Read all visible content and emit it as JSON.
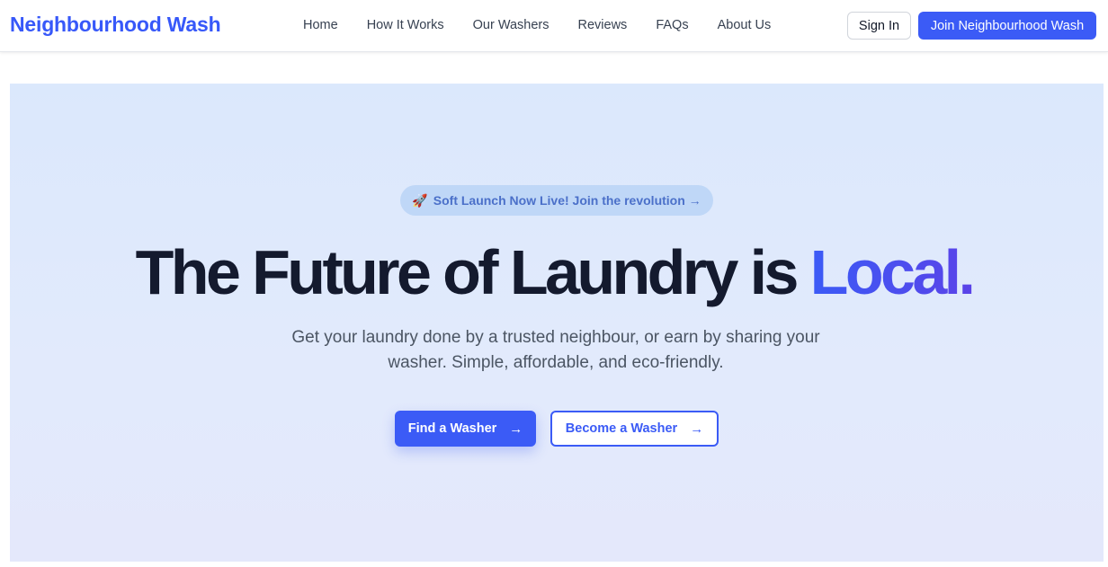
{
  "header": {
    "logo": "Neighbourhood Wash",
    "nav": [
      {
        "label": "Home"
      },
      {
        "label": "How It Works"
      },
      {
        "label": "Our Washers"
      },
      {
        "label": "Reviews"
      },
      {
        "label": "FAQs"
      },
      {
        "label": "About Us"
      }
    ],
    "sign_in_label": "Sign In",
    "join_label": "Join Neighbourhood Wash"
  },
  "hero": {
    "badge_icon": "🚀",
    "badge_text": "Soft Launch Now Live! Join the revolution →",
    "headline_main": "The Future of Laundry is ",
    "headline_accent": "Local.",
    "subtitle": "Get your laundry done by a trusted neighbour, or earn by sharing your washer. Simple, affordable, and eco-friendly.",
    "primary_cta": "Find a Washer",
    "secondary_cta": "Become a Washer",
    "arrow_glyph": "→"
  },
  "colors": {
    "brand": "#3b5bf6",
    "accent_end": "#5a43e8",
    "heading": "#141a2e",
    "hero_bg": "#dbe8fc",
    "badge_bg": "#bfd7f7"
  },
  "icons": {
    "badge_icon": "rocket-icon",
    "cta_icon": "arrow-right-icon"
  }
}
